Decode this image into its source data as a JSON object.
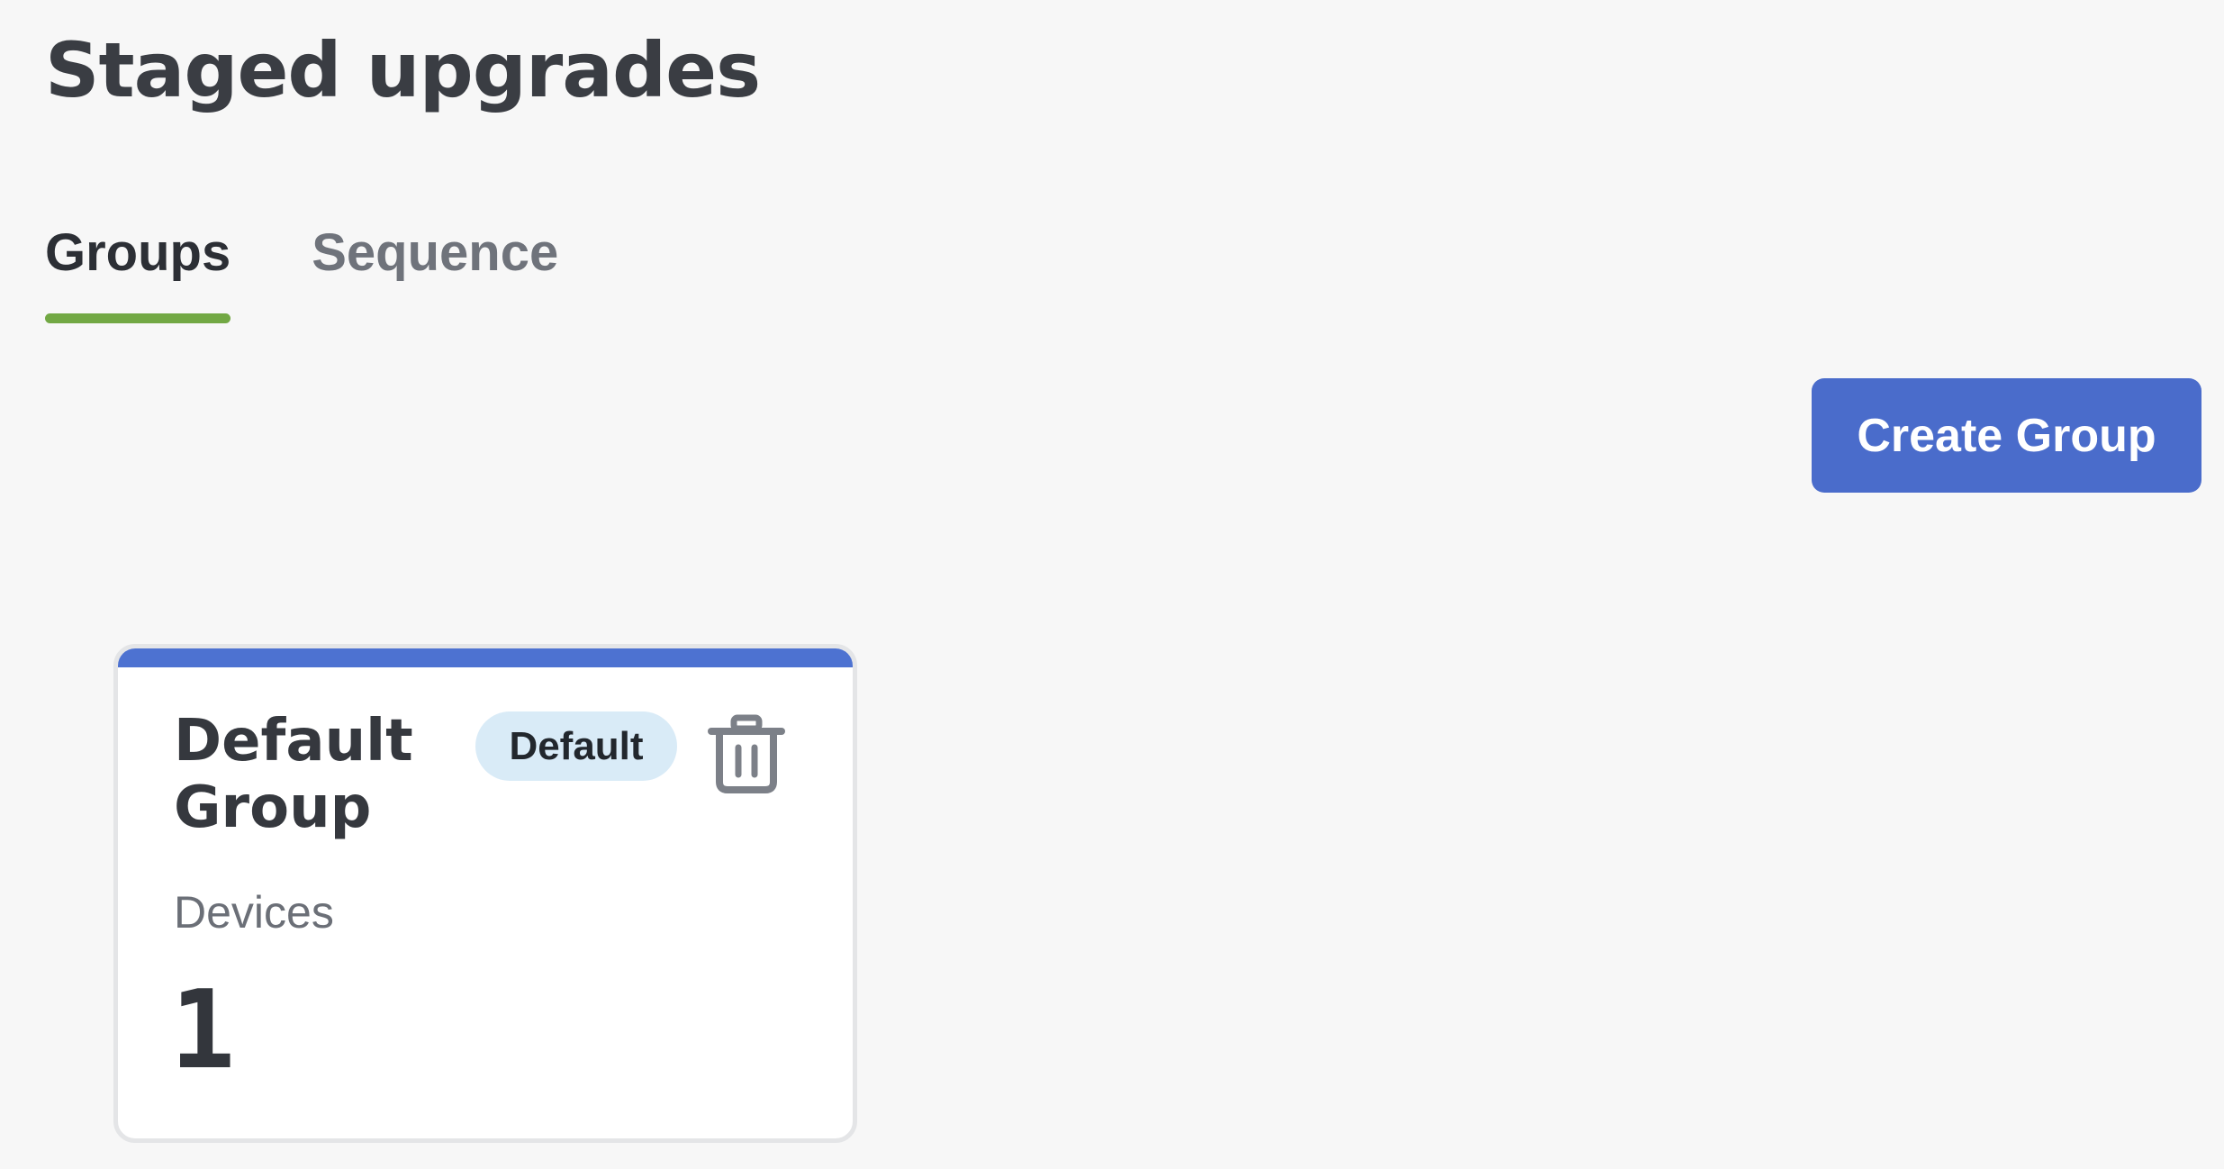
{
  "page": {
    "title": "Staged upgrades"
  },
  "tabs": [
    {
      "label": "Groups",
      "active": true
    },
    {
      "label": "Sequence",
      "active": false
    }
  ],
  "toolbar": {
    "create_group_label": "Create Group"
  },
  "groups": [
    {
      "name": "Default Group",
      "badge": "Default",
      "devices_label": "Devices",
      "devices_count": "1",
      "delete_icon": "trash-icon"
    }
  ],
  "colors": {
    "background": "#f7f7f7",
    "accent_blue": "#4a6ccb",
    "card_top_bar": "#4d72d1",
    "tab_indicator": "#72a844",
    "badge_background": "#d9ebf7",
    "icon_gray": "#7c8088"
  }
}
